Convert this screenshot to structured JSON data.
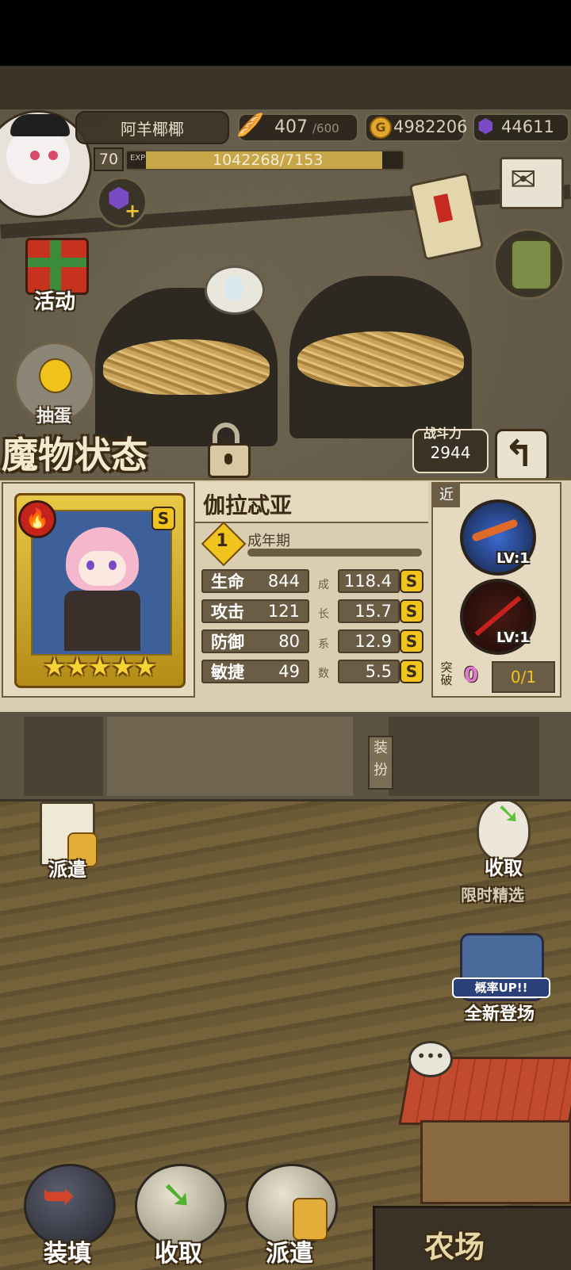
{
  "player": {
    "name": "阿羊椰椰",
    "level": "70",
    "exp_label": "EXP",
    "exp_value": "1042268/7153",
    "exp_fill": 0.93
  },
  "resources": {
    "stamina_current": "407",
    "stamina_max": "/600",
    "gold": "4982206",
    "gems": "44611"
  },
  "side_menu": {
    "activity_label": "活动",
    "gacha_label": "抽蛋"
  },
  "monster_panel": {
    "title": "魔物状态",
    "power_label": "战斗力",
    "power_value": "2944",
    "name": "伽拉忒亚",
    "element": "fire",
    "rank_badge": "S",
    "stars": 5,
    "stage_number": "1",
    "stage_label": "成年期",
    "growth_caption": [
      "成",
      "长",
      "系",
      "数"
    ],
    "stats": [
      {
        "label": "生命",
        "value": "844",
        "growth": "118.4",
        "grade": "S"
      },
      {
        "label": "攻击",
        "value": "121",
        "growth": "15.7",
        "grade": "S"
      },
      {
        "label": "防御",
        "value": "80",
        "growth": "12.9",
        "grade": "S"
      },
      {
        "label": "敏捷",
        "value": "49",
        "growth": "5.5",
        "grade": "S"
      }
    ],
    "range_tag": "近",
    "skills": [
      {
        "level": "LV:1"
      },
      {
        "level": "LV:1"
      }
    ],
    "breakthrough_label_1": "突",
    "breakthrough_label_2": "破",
    "breakthrough_count": "0",
    "breakthrough_progress": "0/1",
    "equip_tab_1": "装",
    "equip_tab_2": "扮"
  },
  "field": {
    "dispatch_label": "派遣",
    "collect_label": "收取",
    "limited_label": "限时精选",
    "rate_up_label": "概率UP!!",
    "new_arrival_label": "全新登场"
  },
  "bottom_bar": {
    "load_label": "装填",
    "collect_label": "收取",
    "dispatch_label": "派遣",
    "farm_label": "农场"
  }
}
